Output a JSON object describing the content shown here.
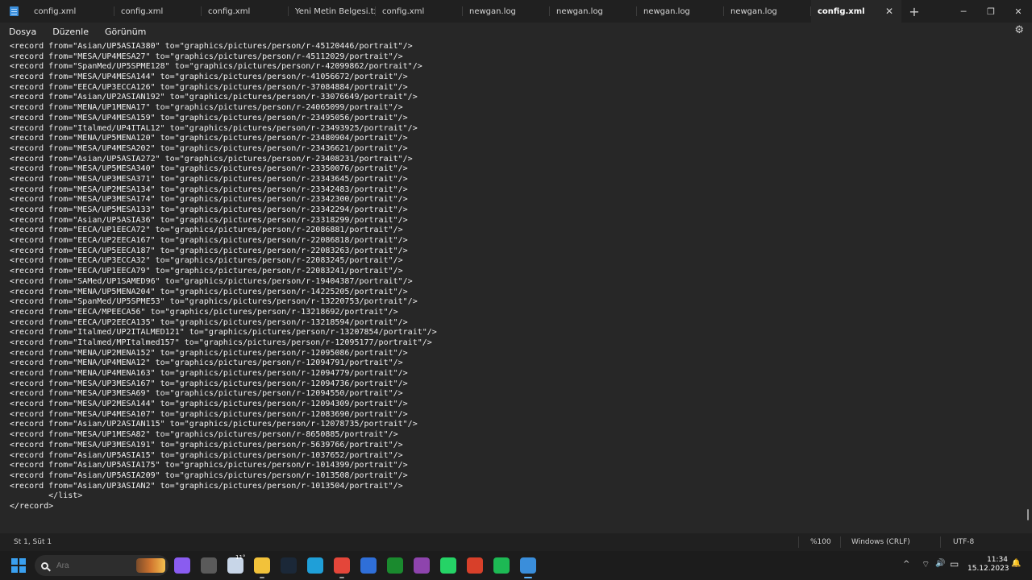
{
  "tabs": [
    {
      "label": "config.xml"
    },
    {
      "label": "config.xml"
    },
    {
      "label": "config.xml"
    },
    {
      "label": "Yeni Metin Belgesi.txt"
    },
    {
      "label": "config.xml"
    },
    {
      "label": "newgan.log"
    },
    {
      "label": "newgan.log"
    },
    {
      "label": "newgan.log"
    },
    {
      "label": "newgan.log"
    },
    {
      "label": "config.xml"
    }
  ],
  "window": {
    "new_tab": "+",
    "minimize": "─",
    "maximize": "❐",
    "close": "✕",
    "tab_close": "✕"
  },
  "menu": {
    "file": "Dosya",
    "edit": "Düzenle",
    "view": "Görünüm",
    "settings_icon": "⚙"
  },
  "editor": {
    "lines": [
      "<record from=\"Asian/UP5ASIA380\" to=\"graphics/pictures/person/r-45120446/portrait\"/>",
      "<record from=\"MESA/UP4MESA27\" to=\"graphics/pictures/person/r-45112029/portrait\"/>",
      "<record from=\"SpanMed/UP5SPME128\" to=\"graphics/pictures/person/r-42099862/portrait\"/>",
      "<record from=\"MESA/UP4MESA144\" to=\"graphics/pictures/person/r-41056672/portrait\"/>",
      "<record from=\"EECA/UP3ECCA126\" to=\"graphics/pictures/person/r-37084884/portrait\"/>",
      "<record from=\"Asian/UP2ASIAN192\" to=\"graphics/pictures/person/r-33076649/portrait\"/>",
      "<record from=\"MENA/UP1MENA17\" to=\"graphics/pictures/person/r-24065099/portrait\"/>",
      "<record from=\"MESA/UP4MESA159\" to=\"graphics/pictures/person/r-23495056/portrait\"/>",
      "<record from=\"Italmed/UP4ITAL12\" to=\"graphics/pictures/person/r-23493925/portrait\"/>",
      "<record from=\"MENA/UP5MENA120\" to=\"graphics/pictures/person/r-23480904/portrait\"/>",
      "<record from=\"MESA/UP4MESA202\" to=\"graphics/pictures/person/r-23436621/portrait\"/>",
      "<record from=\"Asian/UP5ASIA272\" to=\"graphics/pictures/person/r-23408231/portrait\"/>",
      "<record from=\"MESA/UP5MESA340\" to=\"graphics/pictures/person/r-23350076/portrait\"/>",
      "<record from=\"MESA/UP3MESA371\" to=\"graphics/pictures/person/r-23343645/portrait\"/>",
      "<record from=\"MESA/UP2MESA134\" to=\"graphics/pictures/person/r-23342483/portrait\"/>",
      "<record from=\"MESA/UP3MESA174\" to=\"graphics/pictures/person/r-23342300/portrait\"/>",
      "<record from=\"MESA/UP5MESA133\" to=\"graphics/pictures/person/r-23342294/portrait\"/>",
      "<record from=\"Asian/UP5ASIA36\" to=\"graphics/pictures/person/r-23318299/portrait\"/>",
      "<record from=\"EECA/UP1EECA72\" to=\"graphics/pictures/person/r-22086881/portrait\"/>",
      "<record from=\"EECA/UP2EECA167\" to=\"graphics/pictures/person/r-22086818/portrait\"/>",
      "<record from=\"EECA/UP5EECA187\" to=\"graphics/pictures/person/r-22083263/portrait\"/>",
      "<record from=\"EECA/UP3ECCA32\" to=\"graphics/pictures/person/r-22083245/portrait\"/>",
      "<record from=\"EECA/UP1EECA79\" to=\"graphics/pictures/person/r-22083241/portrait\"/>",
      "<record from=\"SAMed/UP1SAMED96\" to=\"graphics/pictures/person/r-19404387/portrait\"/>",
      "<record from=\"MENA/UP5MENA204\" to=\"graphics/pictures/person/r-14225205/portrait\"/>",
      "<record from=\"SpanMed/UP5SPME53\" to=\"graphics/pictures/person/r-13220753/portrait\"/>",
      "<record from=\"EECA/MPEECA56\" to=\"graphics/pictures/person/r-13218692/portrait\"/>",
      "<record from=\"EECA/UP2EECA135\" to=\"graphics/pictures/person/r-13218594/portrait\"/>",
      "<record from=\"Italmed/UP2ITALMED121\" to=\"graphics/pictures/person/r-13207854/portrait\"/>",
      "<record from=\"Italmed/MPItalmed157\" to=\"graphics/pictures/person/r-12095177/portrait\"/>",
      "<record from=\"MENA/UP2MENA152\" to=\"graphics/pictures/person/r-12095086/portrait\"/>",
      "<record from=\"MENA/UP4MENA12\" to=\"graphics/pictures/person/r-12094791/portrait\"/>",
      "<record from=\"MENA/UP4MENA163\" to=\"graphics/pictures/person/r-12094779/portrait\"/>",
      "<record from=\"MESA/UP3MESA167\" to=\"graphics/pictures/person/r-12094736/portrait\"/>",
      "<record from=\"MESA/UP3MESA69\" to=\"graphics/pictures/person/r-12094550/portrait\"/>",
      "<record from=\"MESA/UP2MESA144\" to=\"graphics/pictures/person/r-12094309/portrait\"/>",
      "<record from=\"MESA/UP4MESA107\" to=\"graphics/pictures/person/r-12083690/portrait\"/>",
      "<record from=\"Asian/UP2ASIAN115\" to=\"graphics/pictures/person/r-12078735/portrait\"/>",
      "<record from=\"MESA/UP1MESA82\" to=\"graphics/pictures/person/r-8650885/portrait\"/>",
      "<record from=\"MESA/UP3MESA191\" to=\"graphics/pictures/person/r-5639766/portrait\"/>",
      "<record from=\"Asian/UP5ASIA15\" to=\"graphics/pictures/person/r-1037652/portrait\"/>",
      "<record from=\"Asian/UP5ASIA175\" to=\"graphics/pictures/person/r-1014399/portrait\"/>",
      "<record from=\"Asian/UP5ASIA209\" to=\"graphics/pictures/person/r-1013508/portrait\"/>",
      "<record from=\"Asian/UP3ASIAN2\" to=\"graphics/pictures/person/r-1013504/portrait\"/>",
      "        </list>",
      "</record>"
    ]
  },
  "status": {
    "position": "St 1, Süt 1",
    "zoom": "%100",
    "line_ending": "Windows (CRLF)",
    "encoding": "UTF-8"
  },
  "taskbar": {
    "search_placeholder": "Ara",
    "weather_temp": "11°",
    "icons": [
      {
        "name": "copilot-icon",
        "glyph": "",
        "color": "#8a5cf0"
      },
      {
        "name": "task-view-icon",
        "glyph": "",
        "color": "#5a5a5a"
      },
      {
        "name": "weather-icon",
        "glyph": "",
        "color": "#c8d6e8"
      },
      {
        "name": "file-explorer-icon",
        "glyph": "",
        "color": "#f2c23a"
      },
      {
        "name": "steam-icon",
        "glyph": "",
        "color": "#1b2838"
      },
      {
        "name": "edge-icon",
        "glyph": "",
        "color": "#1f9fd8"
      },
      {
        "name": "chrome-icon",
        "glyph": "",
        "color": "#e4463a"
      },
      {
        "name": "store-icon",
        "glyph": "",
        "color": "#2f6fd8"
      },
      {
        "name": "xbox-icon",
        "glyph": "",
        "color": "#1a8a2e"
      },
      {
        "name": "game-bar-icon",
        "glyph": "",
        "color": "#8e44ad"
      },
      {
        "name": "whatsapp-icon",
        "glyph": "",
        "color": "#25d366"
      },
      {
        "name": "app-red-icon",
        "glyph": "",
        "color": "#d8402a"
      },
      {
        "name": "spotify-icon",
        "glyph": "",
        "color": "#1db954"
      },
      {
        "name": "notepad-icon",
        "glyph": "",
        "color": "#3a8edb"
      }
    ],
    "tray": {
      "chevron": "^",
      "wifi": "⌔",
      "volume": "🔊",
      "battery": "▭",
      "bell": "🔔"
    },
    "time": "11:34",
    "date": "15.12.2023"
  },
  "colors": {
    "accent": "#3a8edb",
    "bg": "#272727",
    "titlebar": "#202020",
    "taskbar": "#1c1c1c"
  }
}
